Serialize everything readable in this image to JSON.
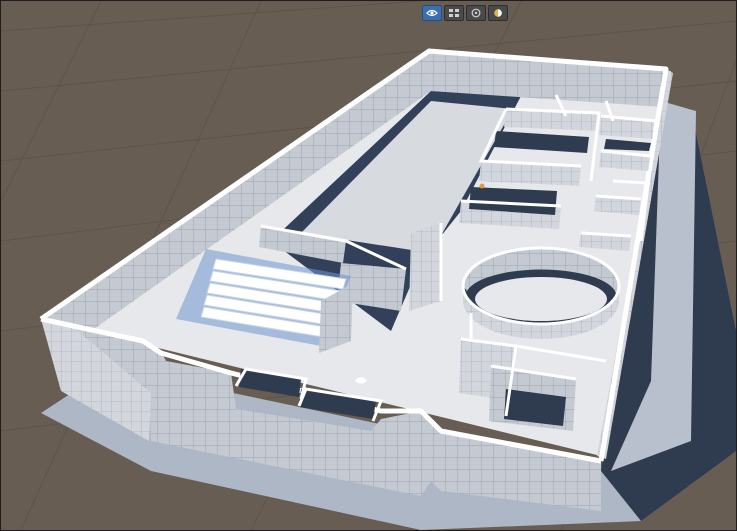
{
  "viewport": {
    "background_color": "#685d52",
    "grid_line_color": "#5d5348",
    "floor_color": "#e9e9e9",
    "wall_color": "#c7ccd3",
    "wall_top_color": "#ffffff",
    "shadow_color": "#2f3b4f",
    "accent_color": "#6f95cf"
  },
  "toolbar": {
    "buttons": [
      {
        "icon": "scene-view-icon",
        "active": true
      },
      {
        "icon": "grid-layout-icon",
        "active": false
      },
      {
        "icon": "gizmo-icon",
        "active": false
      },
      {
        "icon": "lighting-icon",
        "active": false
      }
    ]
  }
}
